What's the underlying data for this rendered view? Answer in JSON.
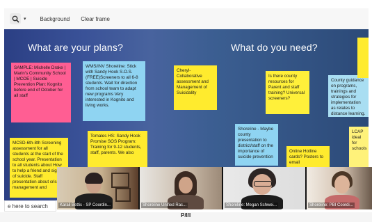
{
  "toolbar": {
    "background_label": "Background",
    "clear_label": "Clear frame",
    "zoom_icon": "zoom-icon"
  },
  "board": {
    "left_title": "What are your plans?",
    "right_title": "What do you need?",
    "notes": [
      {
        "text": "SAMPLE: Michelle Drake | Marin's Community School | MCOE | Suicide Prevention Plan: Kognito before end of October for all staff"
      },
      {
        "text": "WMS/INV Shoreline: Stick with Sandy Hook S.O.S. (FREE)Screeners to all 6-8 students. Wait for direction from school team to adapt new programs Very interested in Kognito and living works."
      },
      {
        "text": "Cheryl- Collaborative assessment and Management of Suicidality"
      },
      {
        "text": "Is there county resources for Parent and staff training? Universal screeners?"
      },
      {
        "text": "County guidance on programs, trainings and strategies for implementation as relates to distance learning."
      },
      {
        "text": "MCSD-6th-8th Screening assessment for all students at the start of the school year. Presentation to all students about How to help a friend and signs of suicide. Staff presentation about crisis management and"
      },
      {
        "text": "Tomales HS: Sandy Hook Promise SOS Program: Training for 9-12 students, staff, parents. We also"
      },
      {
        "text": "Shoreline - Maybe county presentation to district/staff on the importance of suicide prevention"
      },
      {
        "text": "Online Hotline cards? Posters to email"
      },
      {
        "text": "LCAP ideal for schools"
      }
    ],
    "partial_notes": [
      {
        "text": ""
      }
    ]
  },
  "participants": [
    {
      "name": "Karali Bettis - SP Coordin..."
    },
    {
      "name": "Shoreline Unified Rac..."
    },
    {
      "name": "Shoreline: Megan Schwei..."
    },
    {
      "name": "Shoreline: PBI Coordi..."
    }
  ],
  "search": {
    "label": "e here to search"
  },
  "bottom": {
    "text": "P/I/I"
  },
  "colors": {
    "board_bg": "#3a5298",
    "pink_note": "#ff5e93",
    "blue_note": "#8fd4f2",
    "yellow_note": "#ffeb2e"
  }
}
